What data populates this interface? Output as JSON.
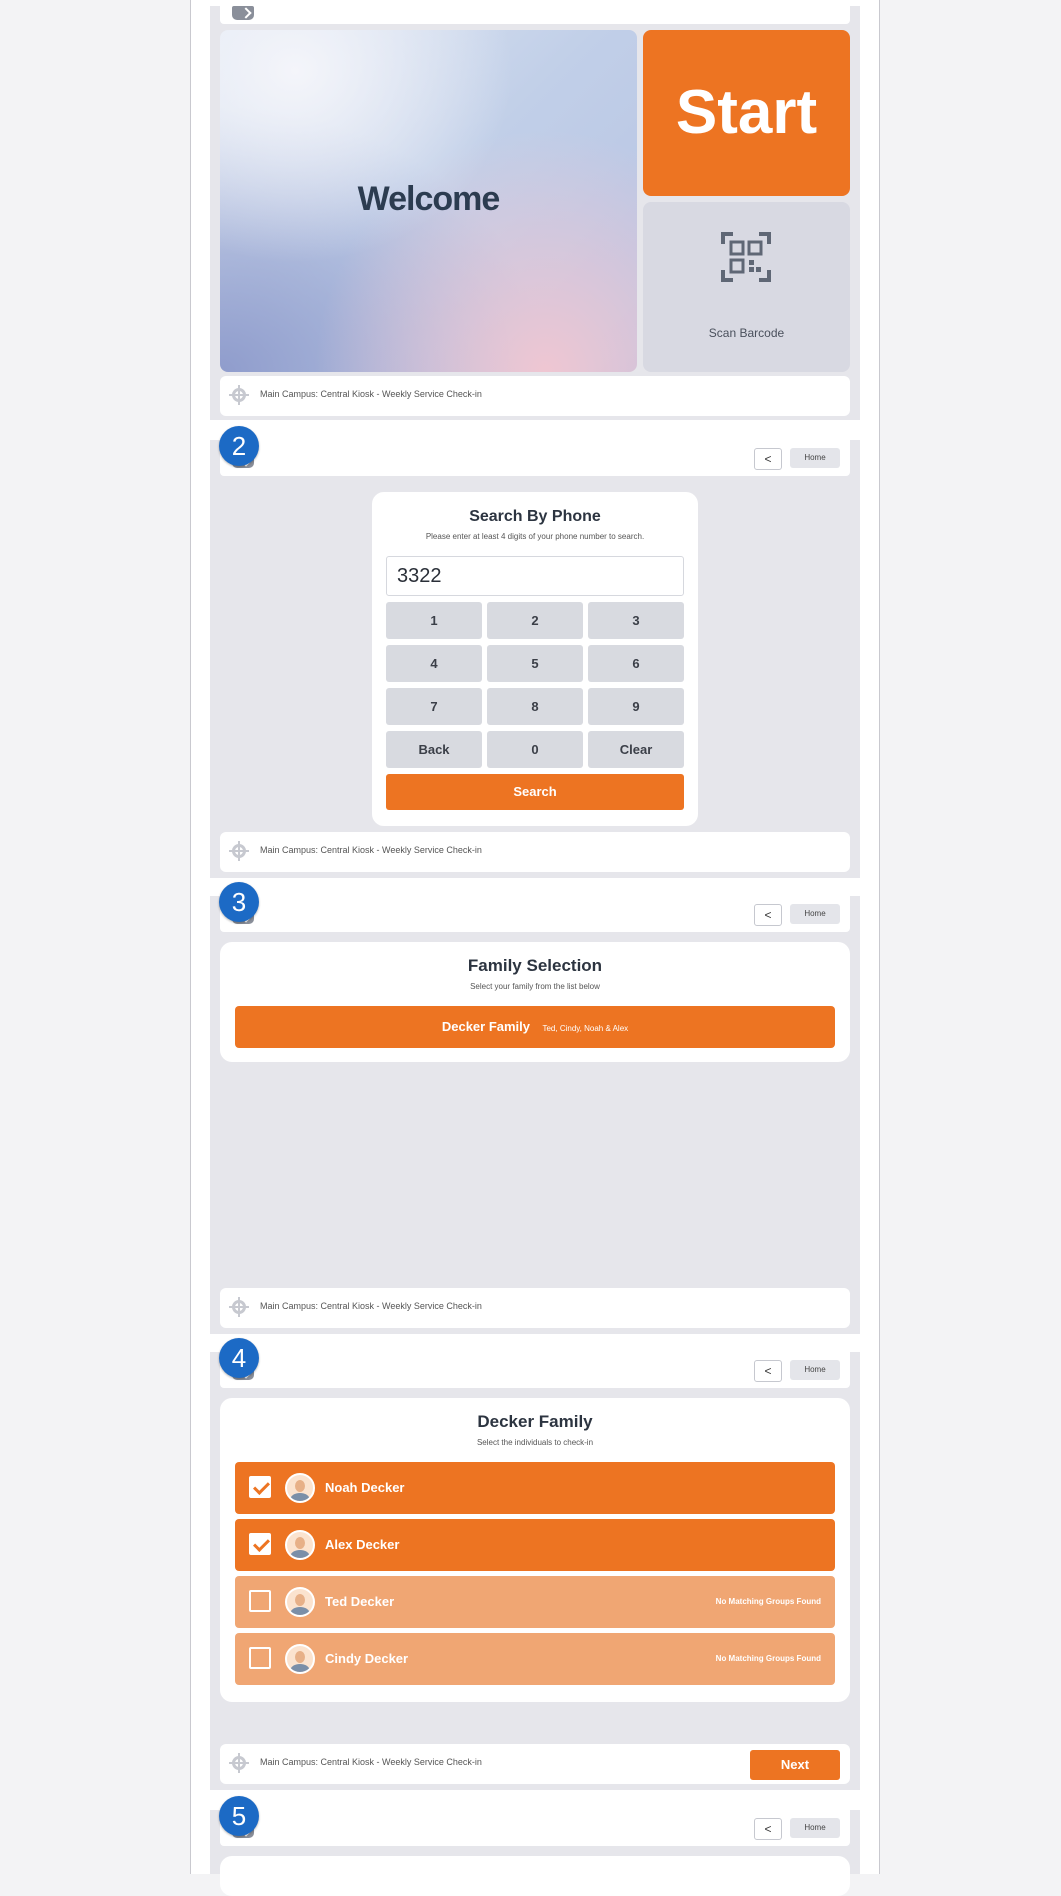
{
  "nav": {
    "back_symbol": "<",
    "home_label": "Home"
  },
  "footer": {
    "location": "Main Campus: Central Kiosk - Weekly Service Check-in"
  },
  "welcome": {
    "title": "Welcome",
    "start_label": "Start",
    "scan_label": "Scan Barcode"
  },
  "steps": {
    "s2": "2",
    "s3": "3",
    "s4": "4",
    "s5": "5"
  },
  "phone_search": {
    "title": "Search By Phone",
    "subtitle": "Please enter at least 4 digits of your phone number to search.",
    "value": "3322",
    "keys": [
      "1",
      "2",
      "3",
      "4",
      "5",
      "6",
      "7",
      "8",
      "9",
      "Back",
      "0",
      "Clear"
    ],
    "search_label": "Search"
  },
  "family_selection": {
    "title": "Family Selection",
    "subtitle": "Select your family from the list below",
    "family_name": "Decker Family",
    "family_members": "Ted, Cindy, Noah & Alex"
  },
  "person_selection": {
    "title": "Decker Family",
    "subtitle": "Select the individuals to check-in",
    "people": [
      {
        "name": "Noah Decker",
        "checked": true,
        "note": ""
      },
      {
        "name": "Alex Decker",
        "checked": true,
        "note": ""
      },
      {
        "name": "Ted Decker",
        "checked": false,
        "note": "No Matching Groups Found"
      },
      {
        "name": "Cindy Decker",
        "checked": false,
        "note": "No Matching Groups Found"
      }
    ],
    "next_label": "Next"
  },
  "colors": {
    "accent": "#ed7422",
    "step_badge": "#1c6ac5",
    "panel": "#e6e6eb"
  }
}
